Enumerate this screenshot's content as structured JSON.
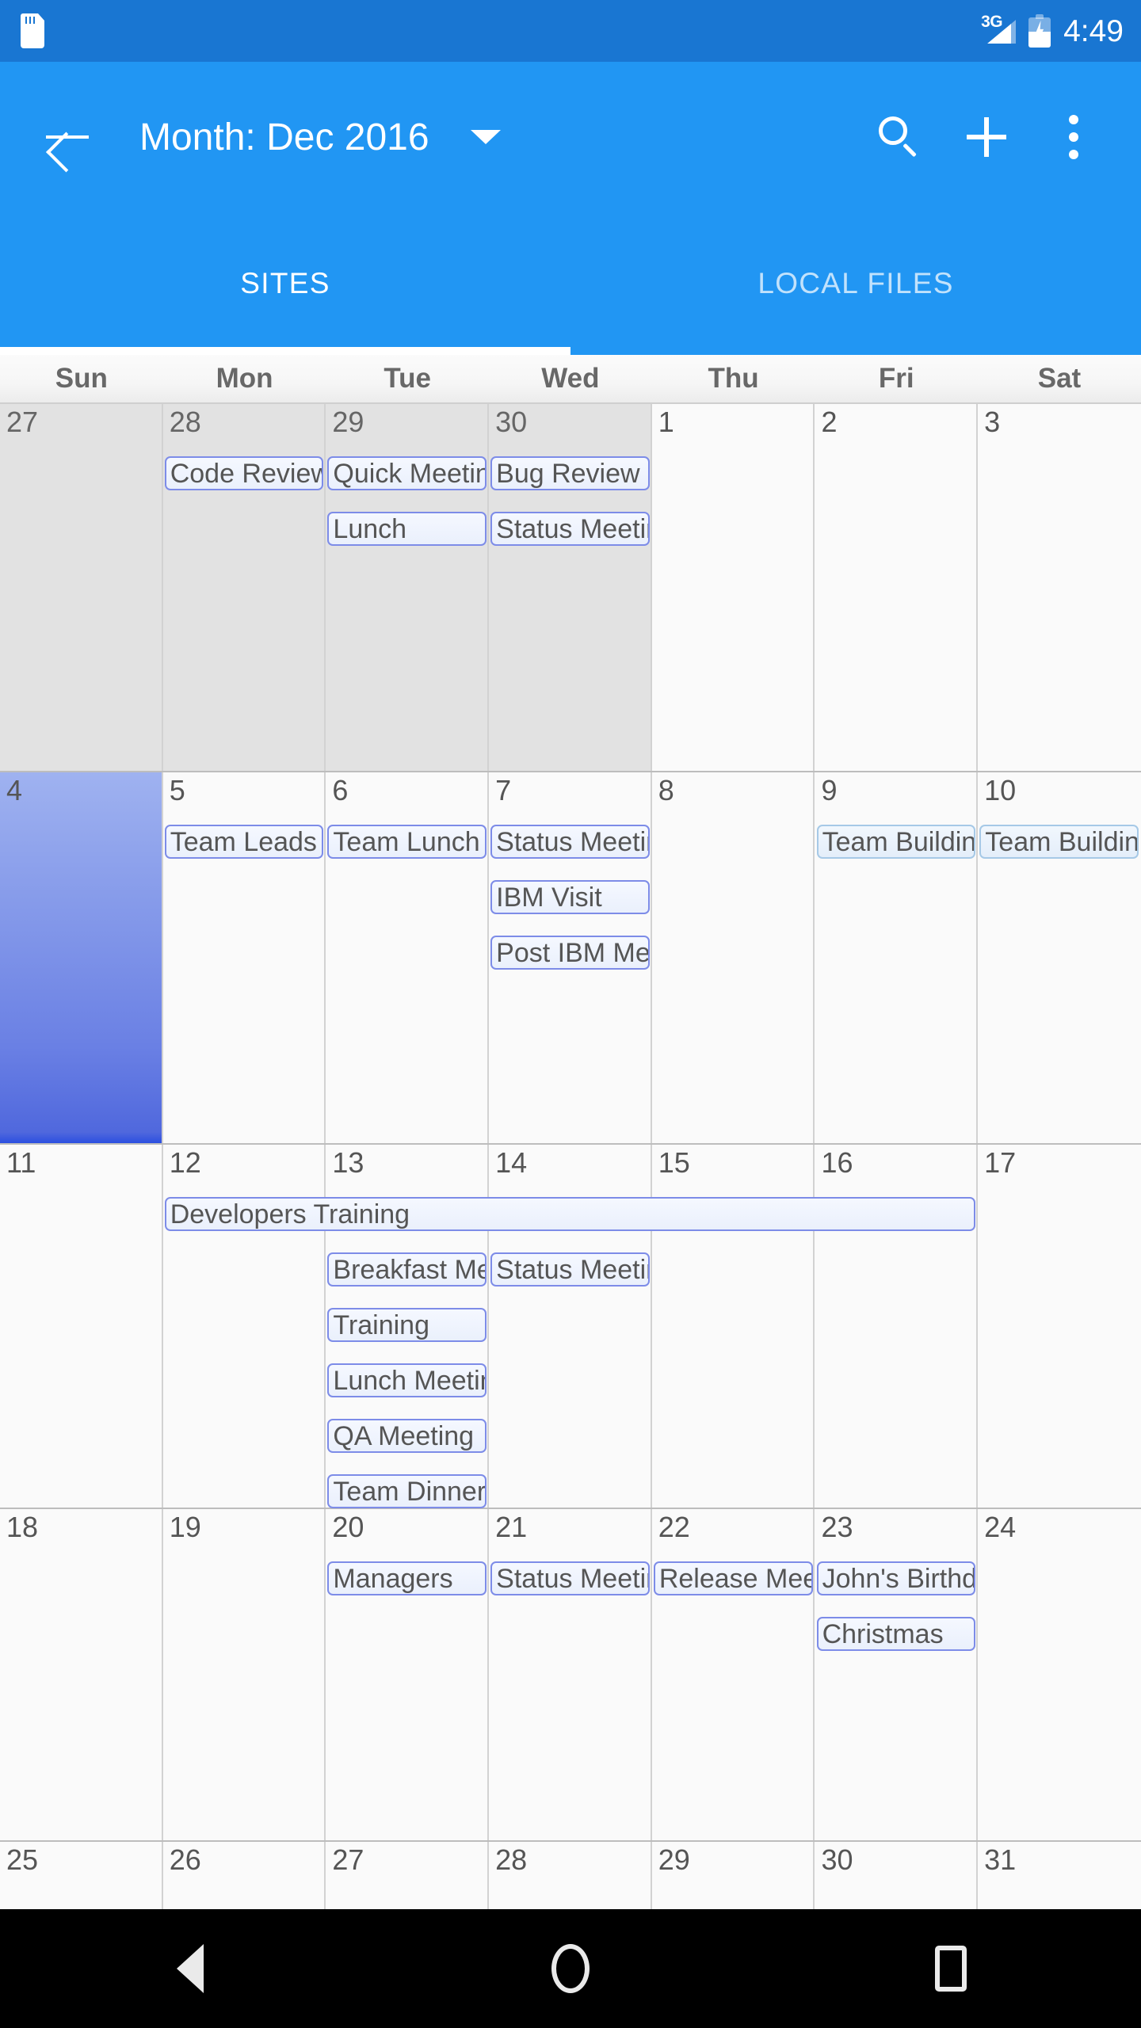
{
  "status_bar": {
    "sd_icon": "sd-card-icon",
    "network": "3G",
    "battery": "battery-charging-icon",
    "time": "4:49"
  },
  "app_bar": {
    "back_icon": "back-arrow-icon",
    "title": "Month: Dec 2016",
    "dropdown_icon": "caret-down-icon",
    "search_icon": "search-icon",
    "add_icon": "plus-icon",
    "overflow_icon": "more-vertical-icon"
  },
  "tabs": [
    {
      "label": "SITES",
      "active": true
    },
    {
      "label": "LOCAL FILES",
      "active": false
    }
  ],
  "calendar": {
    "weekday_headers": [
      "Sun",
      "Mon",
      "Tue",
      "Wed",
      "Thu",
      "Fri",
      "Sat"
    ],
    "weeks": [
      {
        "days": [
          {
            "num": "27",
            "outside": true
          },
          {
            "num": "28",
            "outside": true
          },
          {
            "num": "29",
            "outside": true
          },
          {
            "num": "30",
            "outside": true
          },
          {
            "num": "1",
            "outside": false
          },
          {
            "num": "2",
            "outside": false
          },
          {
            "num": "3",
            "outside": false
          }
        ],
        "events": [
          {
            "title": "Code Review",
            "col": 1,
            "span": 1,
            "row": 0,
            "style": "default"
          },
          {
            "title": "Quick Meeting",
            "col": 2,
            "span": 1,
            "row": 0,
            "style": "default"
          },
          {
            "title": "Bug Review",
            "col": 3,
            "span": 1,
            "row": 0,
            "style": "default"
          },
          {
            "title": "Lunch",
            "col": 2,
            "span": 1,
            "row": 1,
            "style": "default"
          },
          {
            "title": "Status Meeting",
            "col": 3,
            "span": 1,
            "row": 1,
            "style": "default"
          }
        ]
      },
      {
        "days": [
          {
            "num": "4",
            "outside": false,
            "selected": true
          },
          {
            "num": "5",
            "outside": false
          },
          {
            "num": "6",
            "outside": false
          },
          {
            "num": "7",
            "outside": false
          },
          {
            "num": "8",
            "outside": false
          },
          {
            "num": "9",
            "outside": false
          },
          {
            "num": "10",
            "outside": false
          }
        ],
        "events": [
          {
            "title": "Team Leads Meeting",
            "col": 1,
            "span": 1,
            "row": 0,
            "style": "default"
          },
          {
            "title": "Team Lunch",
            "col": 2,
            "span": 1,
            "row": 0,
            "style": "default"
          },
          {
            "title": "Status Meeting",
            "col": 3,
            "span": 1,
            "row": 0,
            "style": "default"
          },
          {
            "title": "Team Building",
            "col": 5,
            "span": 1,
            "row": 0,
            "style": "sky"
          },
          {
            "title": "Team Building",
            "col": 6,
            "span": 1,
            "row": 0,
            "style": "sky"
          },
          {
            "title": "IBM Visit",
            "col": 3,
            "span": 1,
            "row": 1,
            "style": "default"
          },
          {
            "title": "Post IBM Meeting",
            "col": 3,
            "span": 1,
            "row": 2,
            "style": "default"
          }
        ]
      },
      {
        "days": [
          {
            "num": "11",
            "outside": false
          },
          {
            "num": "12",
            "outside": false
          },
          {
            "num": "13",
            "outside": false
          },
          {
            "num": "14",
            "outside": false
          },
          {
            "num": "15",
            "outside": false
          },
          {
            "num": "16",
            "outside": false
          },
          {
            "num": "17",
            "outside": false
          }
        ],
        "events": [
          {
            "title": "Developers Training",
            "col": 1,
            "span": 5,
            "row": 0,
            "style": "default"
          },
          {
            "title": "Breakfast Meeting",
            "col": 2,
            "span": 1,
            "row": 1,
            "style": "default"
          },
          {
            "title": "Status Meeting",
            "col": 3,
            "span": 1,
            "row": 1,
            "style": "default"
          },
          {
            "title": "Training",
            "col": 2,
            "span": 1,
            "row": 2,
            "style": "default"
          },
          {
            "title": "Lunch Meeting",
            "col": 2,
            "span": 1,
            "row": 3,
            "style": "default"
          },
          {
            "title": "QA Meeting",
            "col": 2,
            "span": 1,
            "row": 4,
            "style": "default"
          },
          {
            "title": "Team Dinner",
            "col": 2,
            "span": 1,
            "row": 5,
            "style": "default"
          }
        ]
      },
      {
        "days": [
          {
            "num": "18",
            "outside": false
          },
          {
            "num": "19",
            "outside": false
          },
          {
            "num": "20",
            "outside": false
          },
          {
            "num": "21",
            "outside": false
          },
          {
            "num": "22",
            "outside": false
          },
          {
            "num": "23",
            "outside": false
          },
          {
            "num": "24",
            "outside": false
          }
        ],
        "events": [
          {
            "title": "Managers",
            "col": 2,
            "span": 1,
            "row": 0,
            "style": "default"
          },
          {
            "title": "Status Meeting",
            "col": 3,
            "span": 1,
            "row": 0,
            "style": "default"
          },
          {
            "title": "Release Meeting",
            "col": 4,
            "span": 1,
            "row": 0,
            "style": "default"
          },
          {
            "title": "John's Birthday",
            "col": 5,
            "span": 1,
            "row": 0,
            "style": "default"
          },
          {
            "title": "Christmas",
            "col": 5,
            "span": 1,
            "row": 1,
            "style": "default"
          }
        ]
      },
      {
        "days": [
          {
            "num": "25",
            "outside": false
          },
          {
            "num": "26",
            "outside": false
          },
          {
            "num": "27",
            "outside": false
          },
          {
            "num": "28",
            "outside": false
          },
          {
            "num": "29",
            "outside": false
          },
          {
            "num": "30",
            "outside": false
          },
          {
            "num": "31",
            "outside": false
          }
        ],
        "events": []
      }
    ]
  },
  "nav_bar": {
    "back_icon": "triangle-back-icon",
    "home_icon": "circle-home-icon",
    "recents_icon": "square-recents-icon"
  },
  "colors": {
    "status_bar": "#1976d2",
    "app_bar": "#2196f3",
    "selected_day": "#7d92e8",
    "chip_border": "#7d8ce8",
    "chip_border_sky": "#a6c9e7"
  }
}
